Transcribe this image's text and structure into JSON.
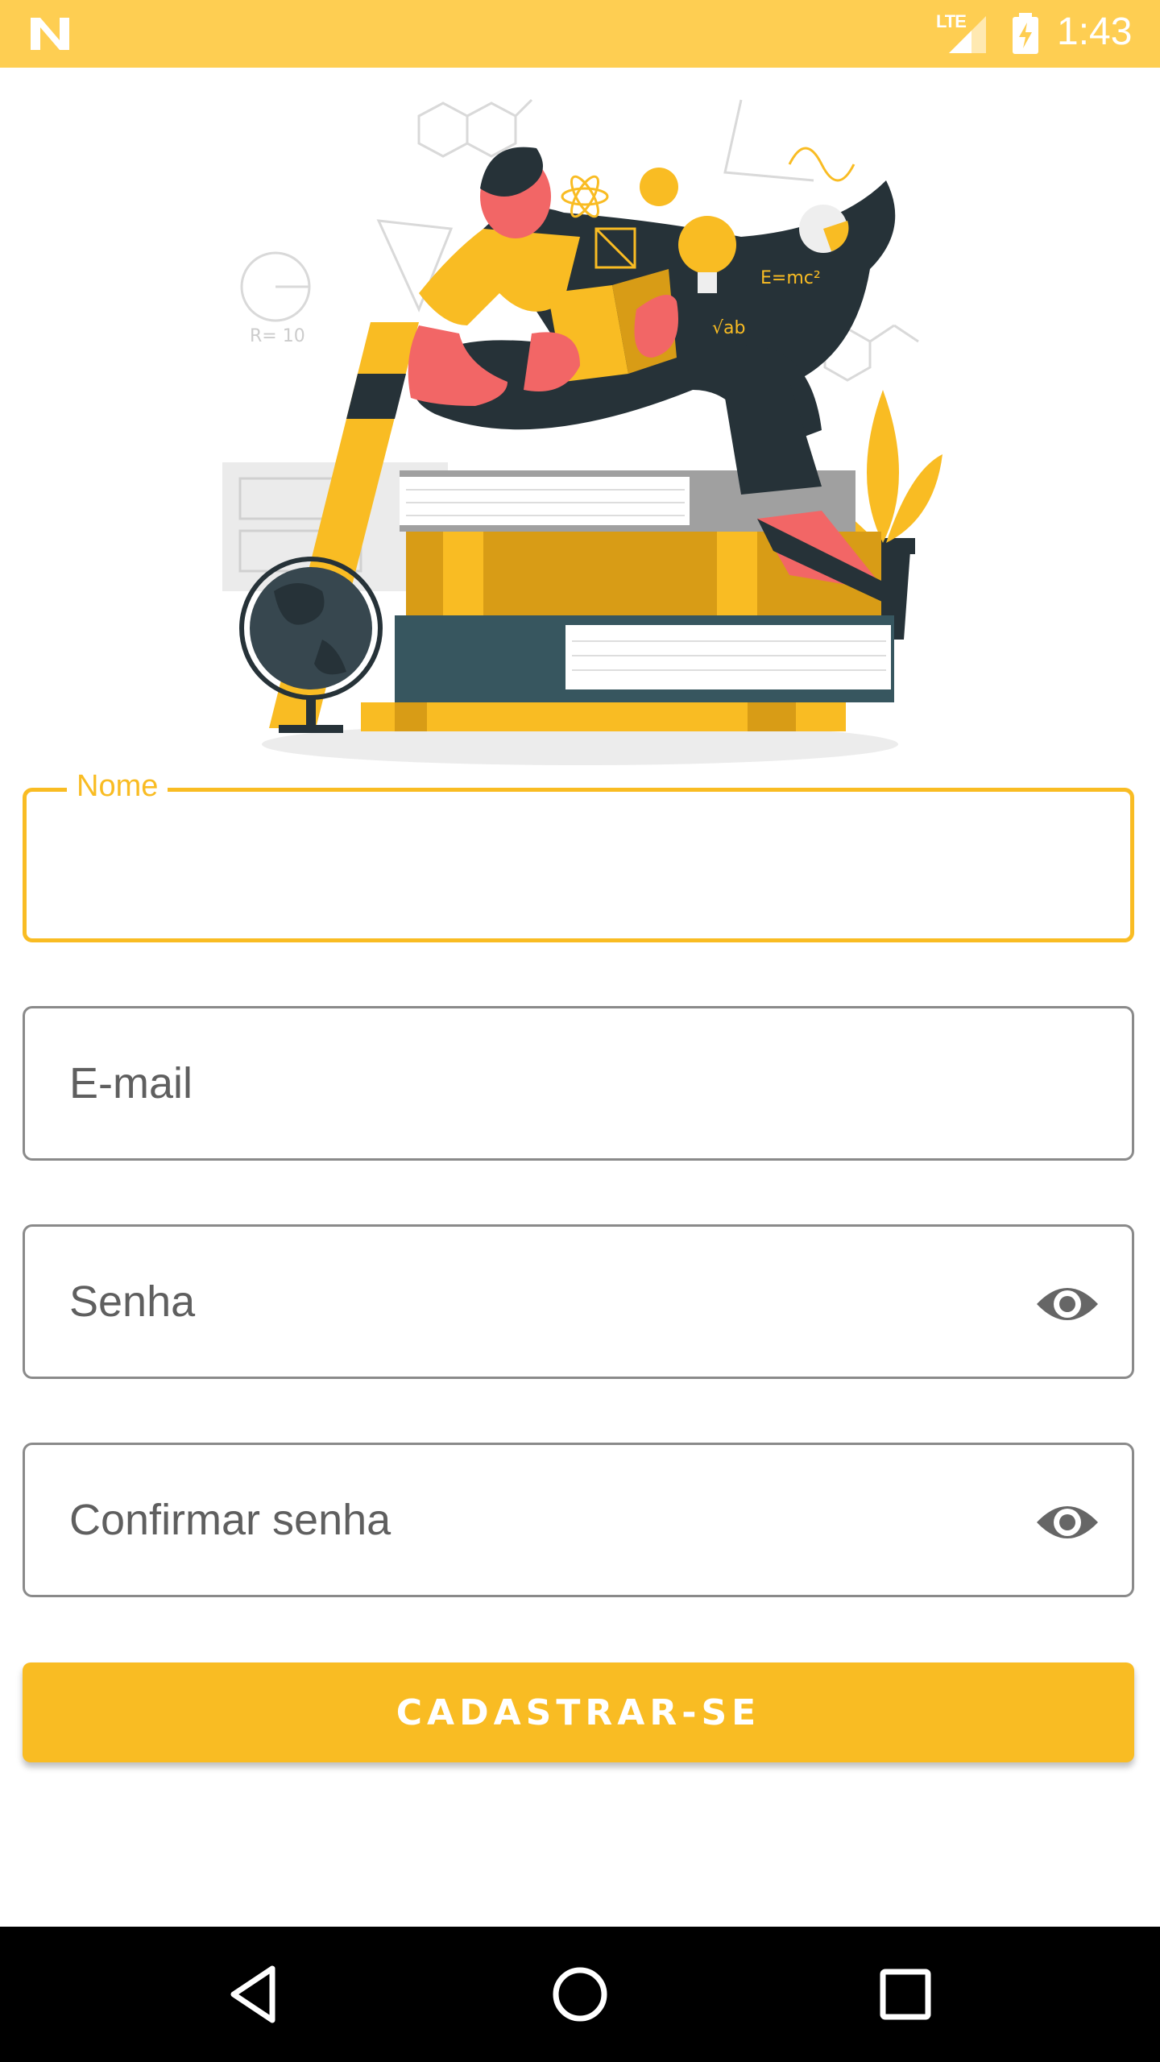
{
  "status_bar": {
    "time": "1:43",
    "network": "LTE",
    "icons": [
      "notification-n-icon",
      "signal-icon",
      "battery-charging-icon"
    ]
  },
  "illustration": {
    "formula": "E=mc²",
    "sqrt_text": "√ab",
    "note_text": "R= 10",
    "colors": {
      "accent": "#F9BC23",
      "dark": "#263238",
      "coral": "#F26666"
    }
  },
  "form": {
    "name_label": "Nome",
    "name_value": "",
    "email_placeholder": "E-mail",
    "password_placeholder": "Senha",
    "confirm_password_placeholder": "Confirmar senha",
    "submit_label": "CADASTRAR-SE"
  },
  "colors": {
    "accent": "#F9BC23",
    "status_bar": "#FECE52",
    "border": "#8a8a8a"
  },
  "nav_bar": {
    "icons": [
      "back-icon",
      "home-icon",
      "recents-icon"
    ]
  }
}
